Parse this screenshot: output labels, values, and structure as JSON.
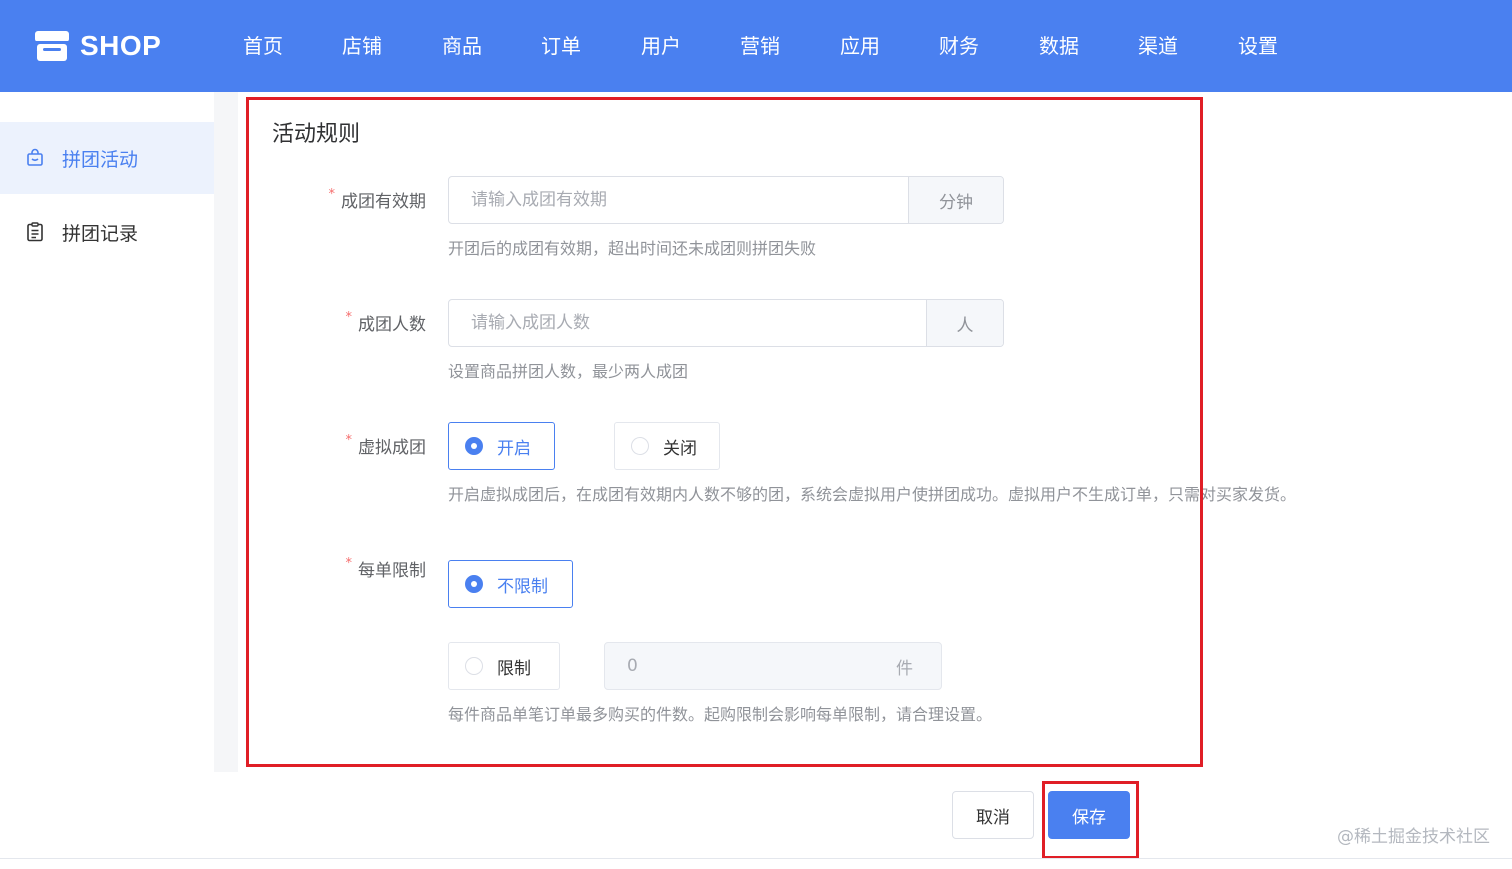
{
  "header": {
    "logo_text": "SHOP",
    "nav": [
      "首页",
      "店铺",
      "商品",
      "订单",
      "用户",
      "营销",
      "应用",
      "财务",
      "数据",
      "渠道",
      "设置"
    ]
  },
  "sidebar": {
    "items": [
      {
        "label": "拼团活动",
        "active": true
      },
      {
        "label": "拼团记录",
        "active": false
      }
    ]
  },
  "form": {
    "title": "活动规则",
    "validity": {
      "label": "成团有效期",
      "placeholder": "请输入成团有效期",
      "suffix": "分钟",
      "hint": "开团后的成团有效期，超出时间还未成团则拼团失败"
    },
    "group_size": {
      "label": "成团人数",
      "placeholder": "请输入成团人数",
      "suffix": "人",
      "hint": "设置商品拼团人数，最少两人成团"
    },
    "virtual": {
      "label": "虚拟成团",
      "options": [
        "开启",
        "关闭"
      ],
      "selected": "开启",
      "hint": "开启虚拟成团后，在成团有效期内人数不够的团，系统会虚拟用户使拼团成功。虚拟用户不生成订单，只需对买家发货。"
    },
    "order_limit": {
      "label": "每单限制",
      "options": [
        "不限制",
        "限制"
      ],
      "selected": "不限制",
      "limit_value": "0",
      "limit_unit": "件",
      "hint": "每件商品单笔订单最多购买的件数。起购限制会影响每单限制，请合理设置。"
    },
    "required_mark": "*"
  },
  "actions": {
    "cancel": "取消",
    "save": "保存"
  },
  "watermark": "@稀土掘金技术社区",
  "colors": {
    "primary": "#4a80f0",
    "highlight": "#e01e26",
    "required": "#f56c6c"
  }
}
